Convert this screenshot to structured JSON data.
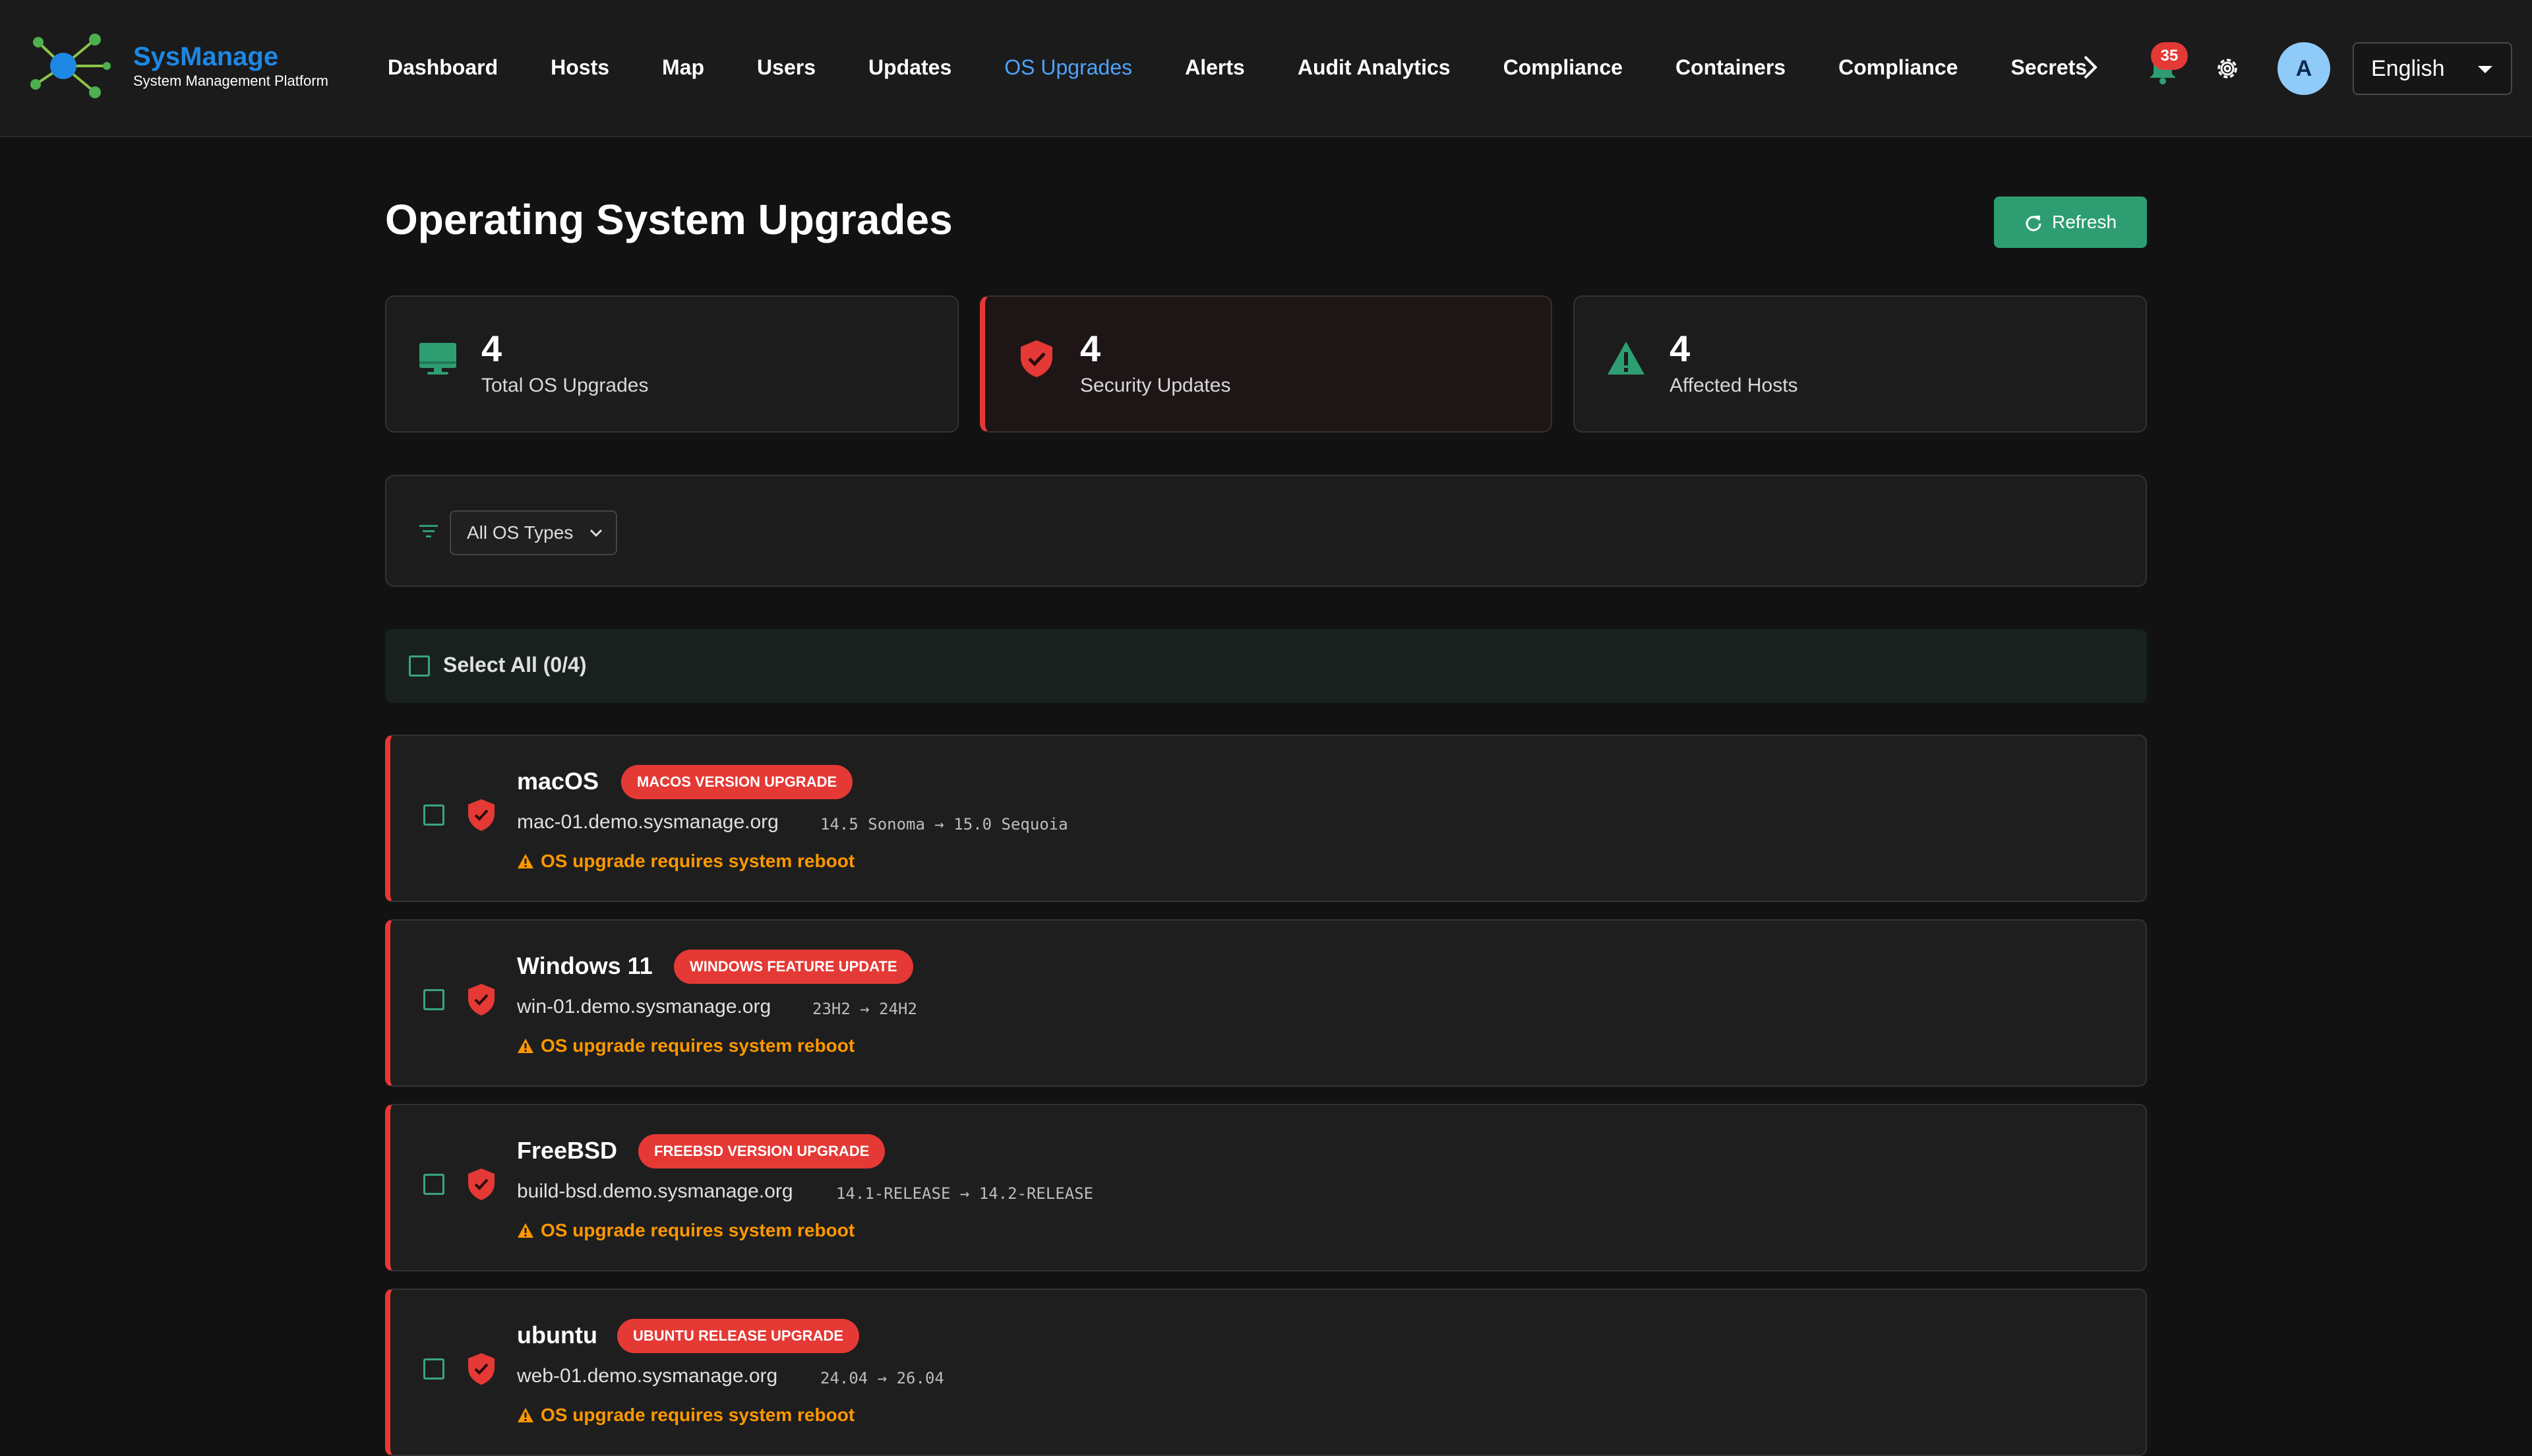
{
  "brand": {
    "name": "SysManage",
    "subtitle": "System Management Platform",
    "accent": "#1e88e5"
  },
  "nav": {
    "items": [
      {
        "label": "Dashboard",
        "active": false
      },
      {
        "label": "Hosts",
        "active": false
      },
      {
        "label": "Map",
        "active": false
      },
      {
        "label": "Users",
        "active": false
      },
      {
        "label": "Updates",
        "active": false
      },
      {
        "label": "OS Upgrades",
        "active": true
      },
      {
        "label": "Alerts",
        "active": false
      },
      {
        "label": "Audit Analytics",
        "active": false
      },
      {
        "label": "Compliance",
        "active": false
      },
      {
        "label": "Containers",
        "active": false
      },
      {
        "label": "Compliance",
        "active": false
      },
      {
        "label": "Secrets",
        "active": false
      }
    ],
    "more_icon": "chevron-right-icon"
  },
  "header_actions": {
    "notifications_count": "35",
    "avatar_initial": "A",
    "language": "English"
  },
  "page": {
    "title": "Operating System Upgrades",
    "refresh_label": "Refresh"
  },
  "stats": [
    {
      "value": "4",
      "label": "Total OS Upgrades",
      "icon": "monitor-icon",
      "color": "#2e9e72"
    },
    {
      "value": "4",
      "label": "Security Updates",
      "icon": "shield-check-icon",
      "color": "#e53935"
    },
    {
      "value": "4",
      "label": "Affected Hosts",
      "icon": "warning-icon",
      "color": "#2e9e72"
    }
  ],
  "filter": {
    "os_type_selected": "All OS Types"
  },
  "select_all": {
    "label": "Select All (0/4)"
  },
  "upgrades": [
    {
      "os": "macOS",
      "type": "MACOS VERSION UPGRADE",
      "host": "mac-01.demo.sysmanage.org",
      "version": "14.5 Sonoma → 15.0 Sequoia",
      "warning": "OS upgrade requires system reboot"
    },
    {
      "os": "Windows 11",
      "type": "WINDOWS FEATURE UPDATE",
      "host": "win-01.demo.sysmanage.org",
      "version": "23H2 → 24H2",
      "warning": "OS upgrade requires system reboot"
    },
    {
      "os": "FreeBSD",
      "type": "FREEBSD VERSION UPGRADE",
      "host": "build-bsd.demo.sysmanage.org",
      "version": "14.1-RELEASE → 14.2-RELEASE",
      "warning": "OS upgrade requires system reboot"
    },
    {
      "os": "ubuntu",
      "type": "UBUNTU RELEASE UPGRADE",
      "host": "web-01.demo.sysmanage.org",
      "version": "24.04 → 26.04",
      "warning": "OS upgrade requires system reboot"
    }
  ],
  "colors": {
    "background": "#121212",
    "success": "#2e9e72",
    "danger": "#e53935",
    "warning": "#ff9800",
    "link": "#4da3ff"
  }
}
